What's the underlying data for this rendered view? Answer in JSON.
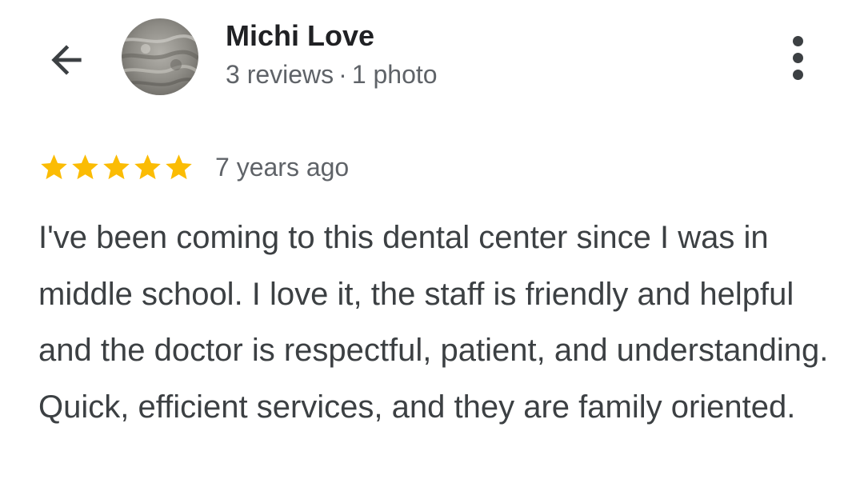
{
  "header": {
    "back_icon": "arrow-back-icon",
    "avatar_icon": "avatar-photo",
    "reviewer_name": "Michi Love",
    "reviews_count": "3 reviews",
    "separator": "·",
    "photos_count": "1 photo",
    "more_icon": "more-vertical-icon"
  },
  "review": {
    "rating": 5,
    "rating_max": 5,
    "star_color": "#fbbc04",
    "time": "7 years ago",
    "text": "I've been coming to this dental center since I was in middle school. I love it, the staff is friendly and helpful and the doctor is respectful, patient, and understanding. Quick, efficient services, and they are family oriented."
  }
}
